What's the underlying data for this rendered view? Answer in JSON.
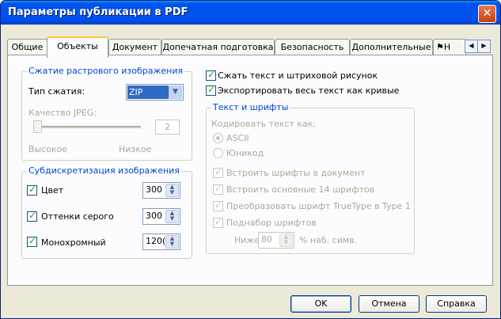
{
  "window": {
    "title": "Параметры публикации в PDF",
    "close_glyph": "✕"
  },
  "tabs": [
    {
      "label": "Общие"
    },
    {
      "label": "Объекты"
    },
    {
      "label": "Документ"
    },
    {
      "label": "Допечатная подготовка"
    },
    {
      "label": "Безопасность"
    },
    {
      "label": "Дополнительные"
    },
    {
      "label": "Н"
    }
  ],
  "tab_scroll": {
    "left": "◀",
    "right": "▶"
  },
  "compression": {
    "legend": "Сжатие растрового изображения",
    "type_label": "Тип сжатия:",
    "type_value": "ZIP",
    "quality_label": "Качество JPEG:",
    "quality_value": "2",
    "high_label": "Высокое",
    "low_label": "Низкое"
  },
  "subsampling": {
    "legend": "Субдискретизация изображения",
    "items": [
      {
        "label": "Цвет",
        "value": "300",
        "checked": true
      },
      {
        "label": "Оттенки серого",
        "value": "300",
        "checked": true
      },
      {
        "label": "Монохромный",
        "value": "120(",
        "checked": true
      }
    ]
  },
  "options": {
    "compress_text": "Сжать текст и штриховой рисунок",
    "export_curves": "Экспортировать весь текст как кривые"
  },
  "fonts": {
    "legend": "Текст и шрифты",
    "encode_label": "Кодировать текст как:",
    "ascii": "ASCII",
    "unicode": "Юникод",
    "embed": "Встроить шрифты в документ",
    "base14": "Встроить основные 14 шрифтов",
    "truetype": "Преобразовать шрифт TrueType в Type 1",
    "subset": "Поднабор шрифтов",
    "below_label": "Ниже",
    "below_value": "80",
    "pct_label": "% наб. симв."
  },
  "buttons": {
    "ok": "OK",
    "cancel": "Отмена",
    "help": "Справка"
  },
  "colors": {
    "titlebar": "#0053ee",
    "legend": "#0046d5",
    "check": "#21a121",
    "active_tab_accent": "#ffc83c"
  }
}
